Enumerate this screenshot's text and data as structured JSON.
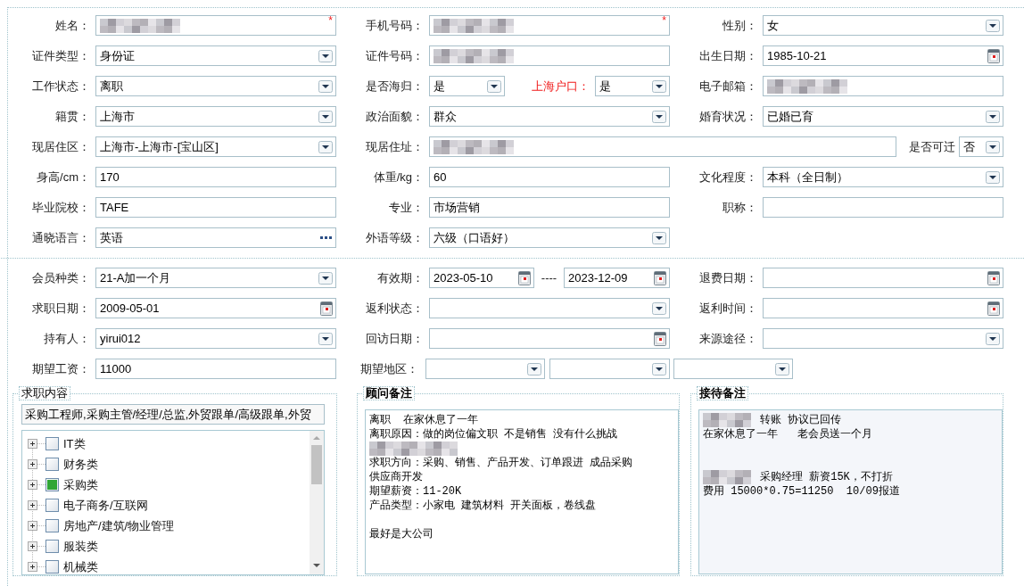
{
  "basic_info": {
    "rows": [
      {
        "items": [
          {
            "kind": "label",
            "label": "姓名："
          },
          {
            "kind": "text",
            "redacted": true,
            "mark": "*"
          },
          {
            "kind": "label",
            "label": "手机号码："
          },
          {
            "kind": "text",
            "redacted": true,
            "mark": "*"
          },
          {
            "kind": "label",
            "label": "性别："
          },
          {
            "kind": "select",
            "value": "女"
          }
        ]
      },
      {
        "items": [
          {
            "kind": "label",
            "label": "证件类型："
          },
          {
            "kind": "select",
            "value": "身份证"
          },
          {
            "kind": "label",
            "label": "证件号码："
          },
          {
            "kind": "text",
            "redacted": true
          },
          {
            "kind": "label",
            "label": "出生日期："
          },
          {
            "kind": "date",
            "value": "1985-10-21"
          }
        ]
      },
      {
        "items": [
          {
            "kind": "label",
            "label": "工作状态："
          },
          {
            "kind": "select",
            "value": "离职"
          },
          {
            "kind": "label",
            "label": "是否海归："
          },
          {
            "kind": "select",
            "value": "是"
          },
          {
            "kind": "label",
            "label": "上海户口：",
            "emphasis": true
          },
          {
            "kind": "select",
            "value": "是"
          },
          {
            "kind": "label",
            "label": "电子邮箱："
          },
          {
            "kind": "text",
            "redacted": true
          }
        ]
      },
      {
        "items": [
          {
            "kind": "label",
            "label": "籍贯："
          },
          {
            "kind": "select",
            "value": "上海市"
          },
          {
            "kind": "label",
            "label": "政治面貌："
          },
          {
            "kind": "select",
            "value": "群众"
          },
          {
            "kind": "label",
            "label": "婚育状况："
          },
          {
            "kind": "select",
            "value": "已婚已育"
          }
        ]
      },
      {
        "items": [
          {
            "kind": "label",
            "label": "现居住区："
          },
          {
            "kind": "select",
            "value": "上海市-上海市-[宝山区]"
          },
          {
            "kind": "label",
            "label": "现居住址："
          },
          {
            "kind": "text",
            "redacted": true
          },
          {
            "kind": "label",
            "label": "是否可迁"
          },
          {
            "kind": "select",
            "value": "否"
          }
        ]
      },
      {
        "items": [
          {
            "kind": "label",
            "label": "身高/cm："
          },
          {
            "kind": "text",
            "value": "170"
          },
          {
            "kind": "label",
            "label": "体重/kg："
          },
          {
            "kind": "text",
            "value": "60"
          },
          {
            "kind": "label",
            "label": "文化程度："
          },
          {
            "kind": "select",
            "value": "本科（全日制）"
          }
        ]
      },
      {
        "items": [
          {
            "kind": "label",
            "label": "毕业院校："
          },
          {
            "kind": "text",
            "value": "TAFE"
          },
          {
            "kind": "label",
            "label": "专业："
          },
          {
            "kind": "text",
            "value": "市场营销"
          },
          {
            "kind": "label",
            "label": "职称："
          },
          {
            "kind": "text"
          }
        ]
      },
      {
        "items": [
          {
            "kind": "label",
            "label": "通晓语言："
          },
          {
            "kind": "dots",
            "value": "英语"
          },
          {
            "kind": "label",
            "label": "外语等级："
          },
          {
            "kind": "select",
            "value": "六级（口语好）"
          }
        ]
      }
    ]
  },
  "membership": {
    "rows": [
      {
        "items": [
          {
            "kind": "label",
            "label": "会员种类："
          },
          {
            "kind": "select",
            "value": "21-A加一个月"
          },
          {
            "kind": "label",
            "label": "有效期："
          },
          {
            "kind": "date",
            "value": "2023-05-10"
          },
          {
            "kind": "separator",
            "label": "----"
          },
          {
            "kind": "date",
            "value": "2023-12-09"
          },
          {
            "kind": "label",
            "label": "退费日期："
          },
          {
            "kind": "date"
          }
        ]
      },
      {
        "items": [
          {
            "kind": "label",
            "label": "求职日期："
          },
          {
            "kind": "date",
            "value": "2009-05-01"
          },
          {
            "kind": "label",
            "label": "返利状态："
          },
          {
            "kind": "select"
          },
          {
            "kind": "label",
            "label": "返利时间："
          },
          {
            "kind": "date"
          }
        ]
      },
      {
        "items": [
          {
            "kind": "label",
            "label": "持有人："
          },
          {
            "kind": "select",
            "value": "yirui012"
          },
          {
            "kind": "label",
            "label": "回访日期："
          },
          {
            "kind": "date"
          },
          {
            "kind": "label",
            "label": "来源途径："
          },
          {
            "kind": "select"
          }
        ]
      },
      {
        "items": [
          {
            "kind": "label",
            "label": "期望工资："
          },
          {
            "kind": "text",
            "value": "11000"
          },
          {
            "kind": "label",
            "label": "期望地区："
          },
          {
            "kind": "select"
          },
          {
            "kind": "select"
          },
          {
            "kind": "select"
          }
        ]
      }
    ]
  },
  "job_content": {
    "legend": "求职内容",
    "selected_text": "采购工程师,采购主管/经理/总监,外贸跟单/高级跟单,外贸",
    "tree": [
      {
        "label": "IT类",
        "checked": false
      },
      {
        "label": "财务类",
        "checked": false
      },
      {
        "label": "采购类",
        "checked": true
      },
      {
        "label": "电子商务/互联网",
        "checked": false
      },
      {
        "label": "房地产/建筑/物业管理",
        "checked": false
      },
      {
        "label": "服装类",
        "checked": false
      },
      {
        "label": "机械类",
        "checked": false
      }
    ]
  },
  "consultant_notes": {
    "legend": "顾问备注",
    "lines": [
      {
        "kind": "text",
        "text": "离职  在家休息了一年"
      },
      {
        "kind": "text",
        "text": "离职原因：做的岗位偏文职 不是销售 没有什么挑战"
      },
      {
        "kind": "redacted"
      },
      {
        "kind": "text",
        "text": "求职方向：采购、销售、产品开发、订单跟进 成品采购"
      },
      {
        "kind": "text",
        "text": "供应商开发"
      },
      {
        "kind": "text",
        "text": "期望薪资：11-20K"
      },
      {
        "kind": "text",
        "text": "产品类型：小家电 建筑材料 开关面板，卷线盘"
      },
      {
        "kind": "blank"
      },
      {
        "kind": "text",
        "text": "最好是大公司"
      }
    ]
  },
  "reception_notes": {
    "legend": "接待备注",
    "lines": [
      {
        "kind": "redacted",
        "text": "转账 协议已回传"
      },
      {
        "kind": "text",
        "text": "在家休息了一年   老会员送一个月"
      },
      {
        "kind": "blank"
      },
      {
        "kind": "blank"
      },
      {
        "kind": "redacted",
        "text": "采购经理 薪资15K，不打折"
      },
      {
        "kind": "text",
        "text": "费用 15000*0.75=11250  10/09报道"
      }
    ]
  }
}
